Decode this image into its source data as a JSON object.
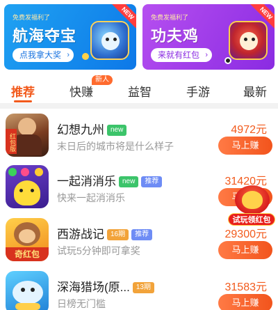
{
  "banners": [
    {
      "ribbon": "NEW",
      "subtitle": "免费发福利了",
      "title": "航海夺宝",
      "cta": "点我拿大奖",
      "chevron": "›"
    },
    {
      "ribbon": "NEW",
      "subtitle": "免费发福利了",
      "title": "功夫鸡",
      "cta": "来就有红包",
      "chevron": "›"
    }
  ],
  "tabs": [
    {
      "label": "推荐",
      "active": true
    },
    {
      "label": "快赚",
      "badge": "新人"
    },
    {
      "label": "益智"
    },
    {
      "label": "手游"
    },
    {
      "label": "最新"
    }
  ],
  "games": [
    {
      "name": "幻想九州",
      "tags": [
        "new"
      ],
      "desc": "末日后的城市将是什么样子",
      "price": "4972元",
      "button": "马上赚",
      "icon_text": "红包版"
    },
    {
      "name": "一起消消乐",
      "tags": [
        "new",
        "推荐"
      ],
      "desc": "快来一起消消乐",
      "price": "31420元",
      "button": "马上赚"
    },
    {
      "name": "西游战记",
      "tags": [
        "16期",
        "推荐"
      ],
      "desc": "试玩5分钟即可拿奖",
      "price": "29300元",
      "button": "马上赚",
      "icon_text": "奇红包"
    },
    {
      "name": "深海猎场(原...",
      "tags": [
        "13期"
      ],
      "desc": "日榜无门槛",
      "price": "31583元",
      "button": "马上赚"
    }
  ],
  "floating_widget": {
    "label": "试玩领红包"
  },
  "colors": {
    "accent": "#f25a1c",
    "banner1": "#1a8cf0",
    "banner2": "#a040ea",
    "tag_new": "#3cc46a",
    "tag_rec": "#6e8cf5",
    "tag_period": "#f2a33a"
  }
}
